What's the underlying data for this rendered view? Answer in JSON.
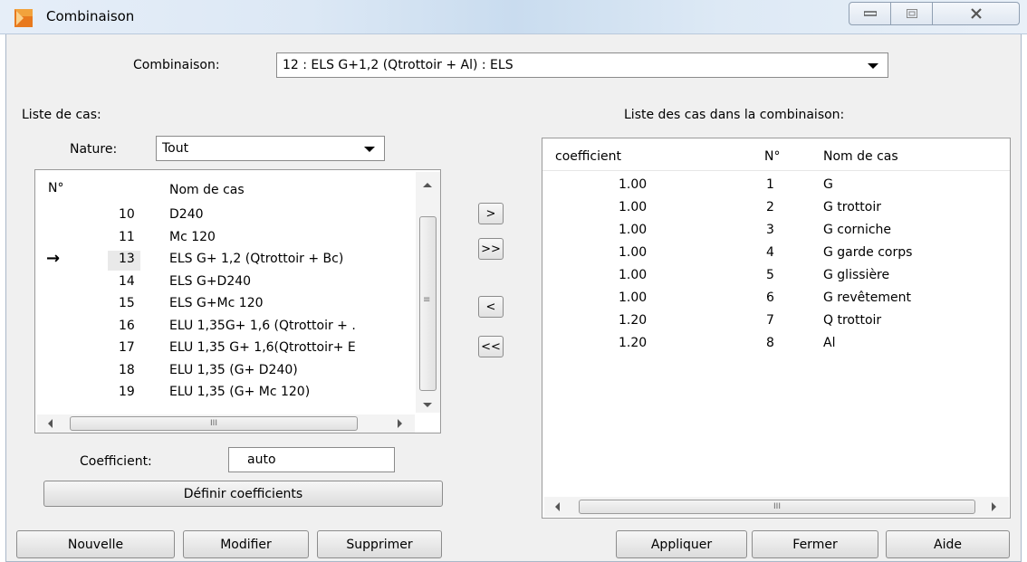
{
  "window": {
    "title": "Combinaison",
    "app_icon": "app-logo-icon",
    "controls": [
      "minimize-icon",
      "maximize-icon",
      "close-icon"
    ]
  },
  "combinaison": {
    "label": "Combinaison:",
    "value": "12 : ELS G+1,2 (Qtrottoir + Al) : ELS"
  },
  "left": {
    "title": "Liste de cas:",
    "nature_label": "Nature:",
    "nature_value": "Tout",
    "columns": [
      "N°",
      "Nom de cas"
    ],
    "rows": [
      {
        "n": "10",
        "name": "D240"
      },
      {
        "n": "11",
        "name": "Mc 120"
      },
      {
        "n": "13",
        "name": "ELS G+ 1,2 (Qtrottoir + Bc)"
      },
      {
        "n": "14",
        "name": "ELS G+D240"
      },
      {
        "n": "15",
        "name": "ELS G+Mc 120"
      },
      {
        "n": "16",
        "name": "ELU 1,35G+ 1,6 (Qtrottoir + ."
      },
      {
        "n": "17",
        "name": "ELU 1,35 G+ 1,6(Qtrottoir+ E"
      },
      {
        "n": "18",
        "name": "ELU 1,35 (G+ D240)"
      },
      {
        "n": "19",
        "name": "ELU 1,35 (G+ Mc 120)"
      }
    ],
    "current_row_marker": "→",
    "hscroll_grip": "III",
    "coefficient_label": "Coefficient:",
    "coefficient_value": "auto",
    "define_button": "Définir coefficients"
  },
  "transfer": {
    "add": ">",
    "add_all": ">>",
    "remove": "<",
    "remove_all": "<<"
  },
  "right": {
    "title": "Liste des cas dans la combinaison:",
    "columns": [
      "coefficient",
      "N°",
      "Nom de cas"
    ],
    "rows": [
      {
        "coef": "1.00",
        "n": "1",
        "name": "G"
      },
      {
        "coef": "1.00",
        "n": "2",
        "name": "G trottoir"
      },
      {
        "coef": "1.00",
        "n": "3",
        "name": "G corniche"
      },
      {
        "coef": "1.00",
        "n": "4",
        "name": "G garde corps"
      },
      {
        "coef": "1.00",
        "n": "5",
        "name": "G glissière"
      },
      {
        "coef": "1.00",
        "n": "6",
        "name": "G revêtement"
      },
      {
        "coef": "1.20",
        "n": "7",
        "name": "Q trottoir"
      },
      {
        "coef": "1.20",
        "n": "8",
        "name": "Al"
      }
    ],
    "hscroll_grip": "III"
  },
  "buttons": {
    "nouvelle": "Nouvelle",
    "modifier": "Modifier",
    "supprimer": "Supprimer",
    "appliquer": "Appliquer",
    "fermer": "Fermer",
    "aide": "Aide"
  },
  "colors": {
    "dialog_bg": "#f0f0f0",
    "titlebar": "#dce8f5",
    "icon_orange": "#e8791e"
  }
}
